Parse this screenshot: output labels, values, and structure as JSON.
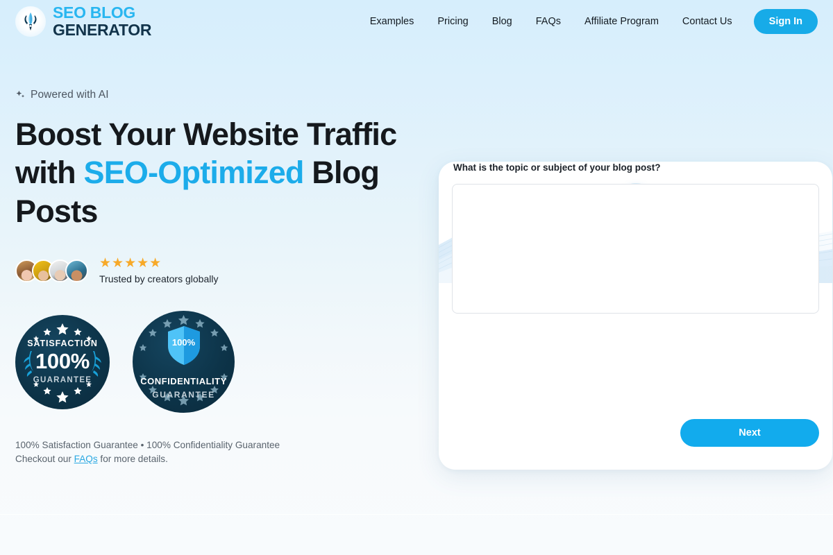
{
  "header": {
    "brand": {
      "line1": "SEO BLOG",
      "line2": "GENERATOR",
      "icon": "quill-pen-icon"
    },
    "nav": [
      {
        "label": "Examples"
      },
      {
        "label": "Pricing"
      },
      {
        "label": "Blog"
      },
      {
        "label": "FAQs"
      },
      {
        "label": "Affiliate Program"
      },
      {
        "label": "Contact Us"
      }
    ],
    "signin_label": "Sign In"
  },
  "hero": {
    "eyebrow": "Powered with AI",
    "eyebrow_icon": "sparkle-icon",
    "headline_part1": "Boost Your Website Traffic with ",
    "headline_accent": "SEO-Optimized",
    "headline_part2": " Blog Posts",
    "stars": "★★★★★",
    "star_count": 5,
    "trusted_text": "Trusted by creators globally",
    "avatars": [
      {
        "name": "avatar-1"
      },
      {
        "name": "avatar-2"
      },
      {
        "name": "avatar-3"
      },
      {
        "name": "avatar-4"
      }
    ]
  },
  "badges": {
    "satisfaction": {
      "title": "SATISFACTION",
      "percent": "100%",
      "subtitle": "GUARANTEE"
    },
    "confidentiality": {
      "shield_percent": "100%",
      "title": "CONFIDENTIALITY",
      "subtitle": "GUARANTEE"
    }
  },
  "guarantee_note": {
    "line1": "100% Satisfaction Guarantee • 100% Confidentiality Guarantee",
    "line2_before": "Checkout our ",
    "link_label": "FAQs",
    "line2_after": " for more details."
  },
  "form_card": {
    "icon": "box-star-icon",
    "question": "What is the topic or subject of your blog post?",
    "topic_value": "",
    "topic_placeholder": "",
    "next_label": "Next"
  },
  "colors": {
    "accent_blue": "#17abe8",
    "brand_dark": "#12344b",
    "star_gold": "#f7a928",
    "badge_navy": "#0d3449",
    "link_blue": "#2aa8e2"
  }
}
